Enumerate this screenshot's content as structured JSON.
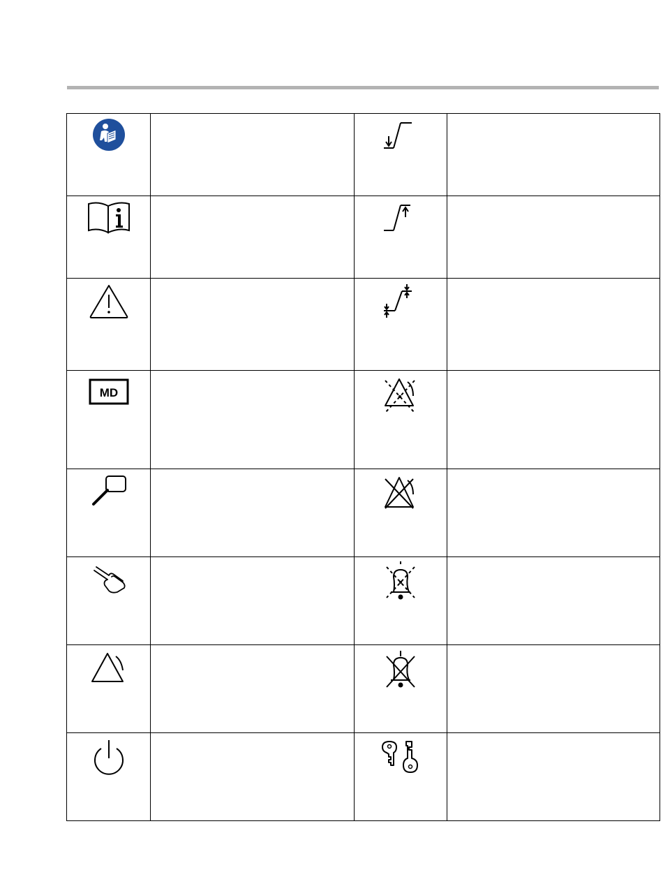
{
  "header_rule_color": "#b3b3b3",
  "symbol_table": {
    "rows": [
      {
        "left": {
          "icon": "read-instructions-mandatory-icon",
          "color": "#1f4f9c",
          "description": ""
        },
        "right": {
          "icon": "lower-limit-icon",
          "description": ""
        }
      },
      {
        "left": {
          "icon": "consult-instructions-for-use-icon",
          "description": ""
        },
        "right": {
          "icon": "upper-limit-icon",
          "description": ""
        }
      },
      {
        "left": {
          "icon": "caution-icon",
          "description": ""
        },
        "right": {
          "icon": "upper-and-lower-limit-icon",
          "description": ""
        }
      },
      {
        "left": {
          "icon": "medical-device-icon",
          "text": "MD",
          "description": ""
        },
        "right": {
          "icon": "alarm-paused-icon",
          "description": ""
        }
      },
      {
        "left": {
          "icon": "zoom-magnifier-icon",
          "description": ""
        },
        "right": {
          "icon": "alarm-off-icon",
          "description": ""
        }
      },
      {
        "left": {
          "icon": "touch-point-hand-icon",
          "description": ""
        },
        "right": {
          "icon": "audio-paused-icon",
          "description": ""
        }
      },
      {
        "left": {
          "icon": "alarm-triangle-icon",
          "description": ""
        },
        "right": {
          "icon": "audio-off-icon",
          "description": ""
        }
      },
      {
        "left": {
          "icon": "power-standby-icon",
          "description": ""
        },
        "right": {
          "icon": "key-lock-icon",
          "description": ""
        }
      }
    ]
  }
}
